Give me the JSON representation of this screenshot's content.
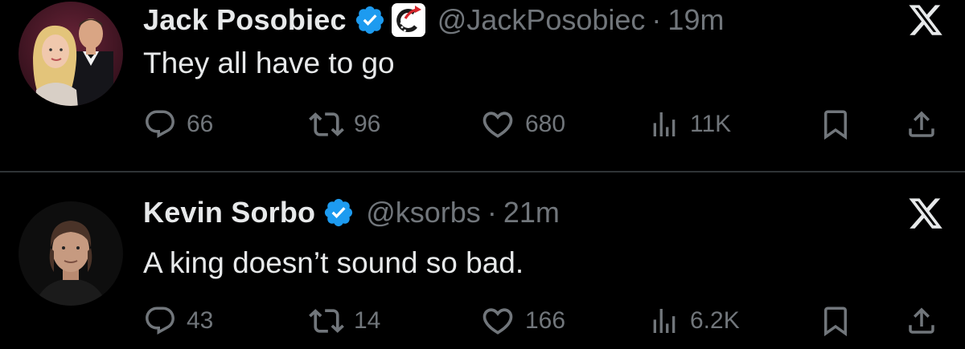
{
  "tweets": [
    {
      "display_name": "Jack Posobiec",
      "handle": "@JackPosobiec",
      "separator": "·",
      "time": "19m",
      "text": "They all have to go",
      "avatar": "avatar-couple-photo",
      "verified": true,
      "affiliate_badge": true,
      "replies": "66",
      "retweets": "96",
      "likes": "680",
      "views": "11K"
    },
    {
      "display_name": "Kevin Sorbo",
      "handle": "@ksorbs",
      "separator": "·",
      "time": "21m",
      "text": "A king doesn’t sound so bad.",
      "avatar": "avatar-man-photo",
      "verified": true,
      "affiliate_badge": false,
      "replies": "43",
      "retweets": "14",
      "likes": "166",
      "views": "6.2K"
    }
  ],
  "icons": {
    "verified": "verified-badge-icon",
    "affiliate": "affiliate-badge-icon",
    "x_logo": "x-logo-icon",
    "reply": "reply-icon",
    "retweet": "retweet-icon",
    "like": "heart-icon",
    "views": "views-icon",
    "bookmark": "bookmark-icon",
    "share": "share-icon"
  },
  "colors": {
    "background": "#000000",
    "text": "#e7e9ea",
    "secondary": "#71767b",
    "verified": "#1d9bf0",
    "divider": "#2f3336",
    "affiliate_red": "#d6242a"
  }
}
